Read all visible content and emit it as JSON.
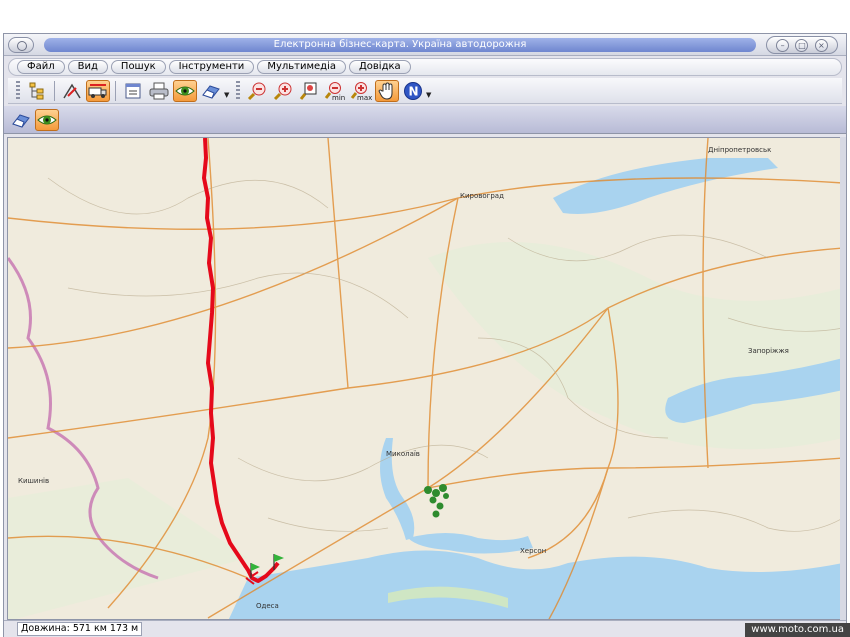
{
  "window": {
    "title": "Електронна бізнес-карта. Україна автодорожня",
    "controls": [
      "минимизировать",
      "развернуть",
      "закрыть"
    ]
  },
  "menu": {
    "items": [
      "Файл",
      "Вид",
      "Пошук",
      "Інструменти",
      "Мультимедіа",
      "Довідка"
    ]
  },
  "toolbar": {
    "buttons": [
      {
        "icon": "layers-tree-icon"
      },
      {
        "icon": "route-measure-icon"
      },
      {
        "icon": "truck-route-icon",
        "active": true
      },
      {
        "icon": "legend-list-icon"
      },
      {
        "icon": "printer-icon"
      },
      {
        "icon": "eye-view-icon",
        "active": true
      },
      {
        "icon": "eraser-icon"
      },
      {
        "icon": "zoom-out-icon"
      },
      {
        "icon": "zoom-in-icon"
      },
      {
        "icon": "zoom-window-icon"
      },
      {
        "icon": "zoom-min-icon",
        "sub": "min"
      },
      {
        "icon": "zoom-max-icon",
        "sub": "max"
      },
      {
        "icon": "hand-pan-icon",
        "active": true
      },
      {
        "icon": "north-compass-icon",
        "letter": "N"
      }
    ]
  },
  "toolbar2": {
    "buttons": [
      {
        "icon": "eraser-icon"
      },
      {
        "icon": "eye-view-icon",
        "active": true
      }
    ]
  },
  "map": {
    "place_labels": [
      "Кировоград",
      "Кишинів",
      "Одеса",
      "Миколаїв",
      "Херсон",
      "Запоріжжя",
      "Дніпропетровськ"
    ],
    "colors": {
      "land": "#f0ebdd",
      "water": "#a9d3ef",
      "route": "#e5091b",
      "roads": "#e08a2e",
      "border": "#c879b3",
      "markers": "#2e8b2e"
    }
  },
  "status": {
    "length_text": "Довжина: 571 км 173 м"
  },
  "watermark": "www.moto.com.ua"
}
